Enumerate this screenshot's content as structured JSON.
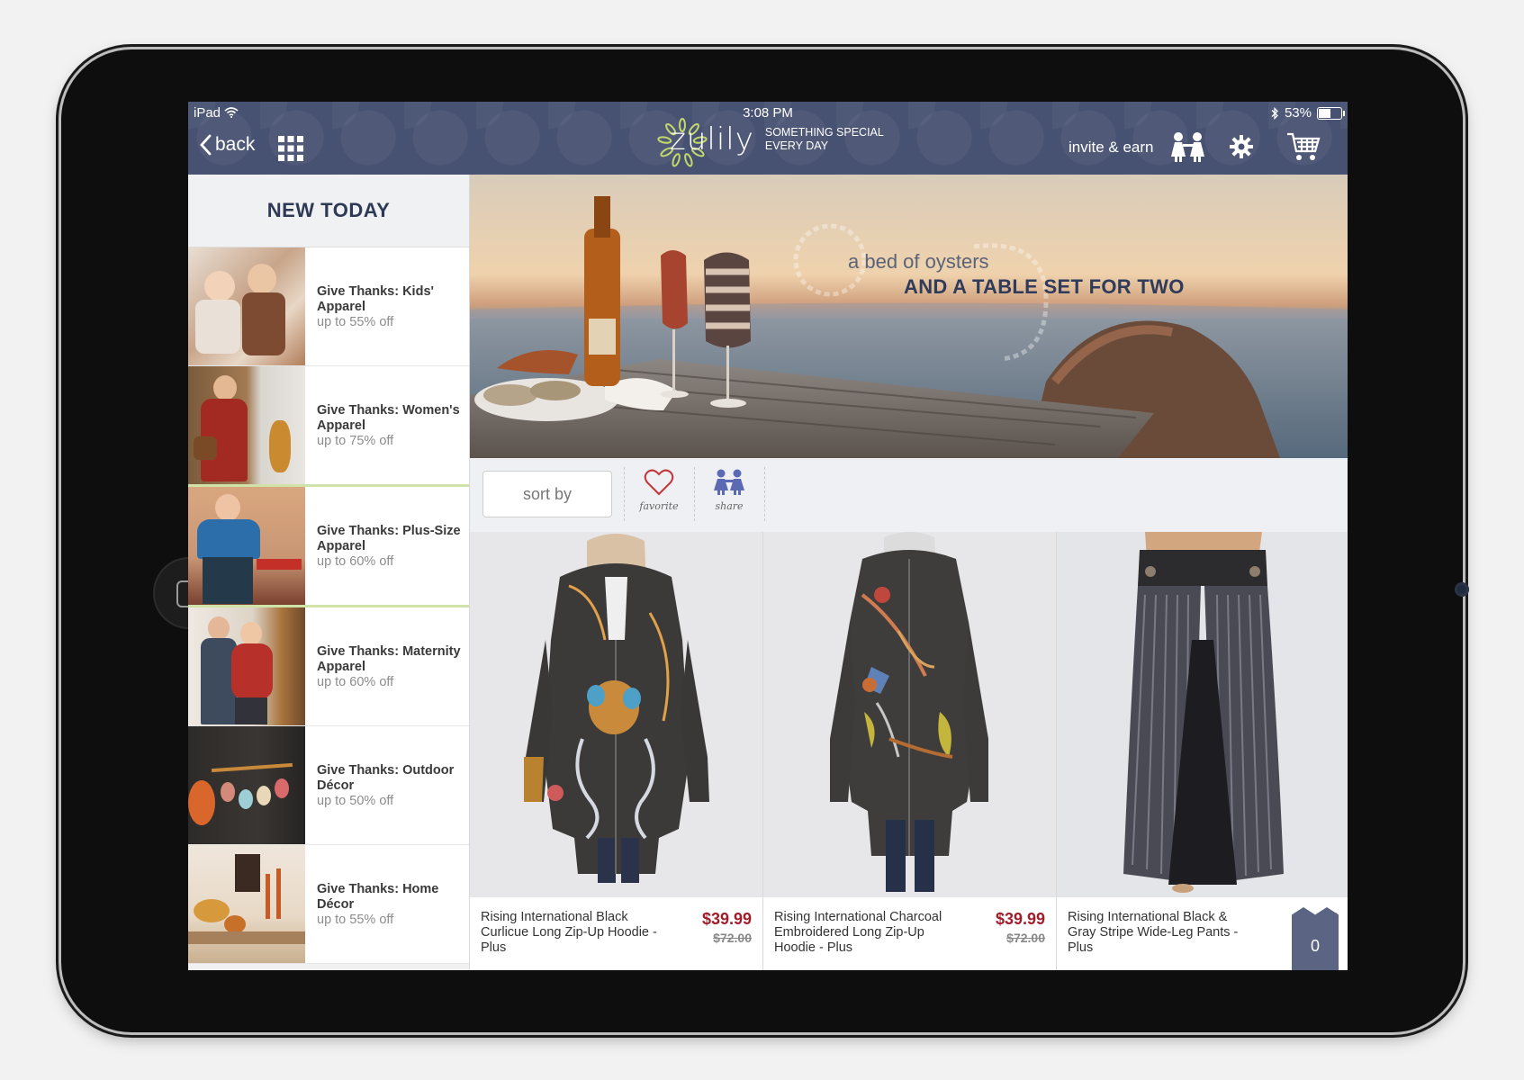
{
  "status_bar": {
    "device": "iPad",
    "time": "3:08 PM",
    "battery": "53%"
  },
  "nav": {
    "back_label": "back",
    "logo_text": "zulily",
    "tagline_line1": "SOMETHING SPECIAL",
    "tagline_line2": "EVERY DAY",
    "invite_label": "invite & earn"
  },
  "sidebar": {
    "title": "NEW TODAY",
    "items": [
      {
        "name": "Give Thanks: Kids' Apparel",
        "discount": "up to 55% off"
      },
      {
        "name": "Give Thanks: Women's Apparel",
        "discount": "up to 75% off"
      },
      {
        "name": "Give Thanks: Plus-Size Apparel",
        "discount": "up to 60% off"
      },
      {
        "name": "Give Thanks: Maternity Apparel",
        "discount": "up to 60% off"
      },
      {
        "name": "Give Thanks: Outdoor Décor",
        "discount": "up to 50% off"
      },
      {
        "name": "Give Thanks: Home Décor",
        "discount": "up to 55% off"
      }
    ]
  },
  "hero": {
    "line1": "a bed of oysters",
    "line2": "AND A TABLE SET FOR TWO"
  },
  "toolbar": {
    "sort_label": "sort by",
    "favorite_label": "favorite",
    "share_label": "share"
  },
  "products": [
    {
      "name": "Rising International Black Curlicue Long Zip-Up Hoodie - Plus",
      "price": "$39.99",
      "was": "$72.00"
    },
    {
      "name": "Rising International Charcoal Embroidered Long Zip-Up Hoodie - Plus",
      "price": "$39.99",
      "was": "$72.00"
    },
    {
      "name": "Rising International Black & Gray Stripe Wide-Leg Pants - Plus",
      "price": "$",
      "was": ""
    }
  ],
  "cart": {
    "count": "0"
  },
  "colors": {
    "nav_bg": "#475171",
    "price_red": "#a11d2a",
    "accent_green": "#cfe3a9"
  }
}
